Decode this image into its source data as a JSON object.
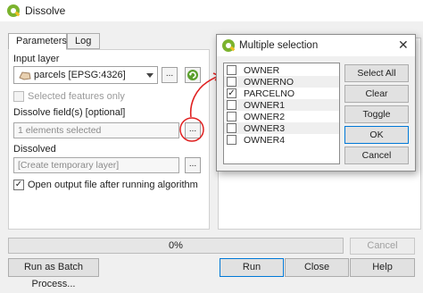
{
  "window": {
    "title": "Dissolve"
  },
  "tabs": [
    {
      "label": "Parameters"
    },
    {
      "label": "Log"
    }
  ],
  "params": {
    "input_layer_label": "Input layer",
    "input_layer_value": "parcels [EPSG:4326]",
    "selected_features_label": "Selected features only",
    "dissolve_fields_label": "Dissolve field(s) [optional]",
    "dissolve_fields_value": "1 elements selected",
    "dissolved_label": "Dissolved",
    "dissolved_placeholder": "[Create temporary layer]",
    "open_output_label": "Open output file after running algorithm",
    "more_button": "...",
    "open_output_checked": true,
    "selected_features_checked": false
  },
  "modal": {
    "title": "Multiple selection",
    "items": [
      {
        "label": "OWNER",
        "checked": false
      },
      {
        "label": "OWNERNO",
        "checked": false
      },
      {
        "label": "PARCELNO",
        "checked": true
      },
      {
        "label": "OWNER1",
        "checked": false
      },
      {
        "label": "OWNER2",
        "checked": false
      },
      {
        "label": "OWNER3",
        "checked": false
      },
      {
        "label": "OWNER4",
        "checked": false
      }
    ],
    "buttons": {
      "select_all": "Select All",
      "clear_selection": "Clear Selection",
      "toggle_selection": "Toggle Selection",
      "ok": "OK",
      "cancel": "Cancel"
    }
  },
  "progress": {
    "text": "0%",
    "value": 0
  },
  "bottom_buttons": {
    "cancel": "Cancel",
    "batch": "Run as Batch Process...",
    "run": "Run",
    "close": "Close",
    "help": "Help"
  },
  "colors": {
    "annotation": "#e02020",
    "qgis_green": "#7bb32e",
    "selection": "#cce8ff"
  },
  "icons": [
    "qgis-logo-icon",
    "polygon-layer-icon",
    "iterate-icon",
    "close-icon",
    "checkmark-icon"
  ]
}
